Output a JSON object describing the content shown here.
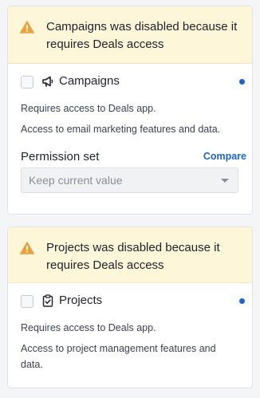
{
  "colors": {
    "warning_background": "#fdf6d8",
    "warning_icon": "#e8a33d",
    "link_blue": "#1a64d0",
    "status_dot": "#1a64d0"
  },
  "campaigns": {
    "warning": "Campaigns was disabled because it requires Deals access",
    "warning_icon": "warning-triangle-icon",
    "app_icon": "megaphone-icon",
    "label": "Campaigns",
    "checked": false,
    "requires": "Requires access to Deals app.",
    "access": "Access to email marketing features and data.",
    "permission_label": "Permission set",
    "compare_label": "Compare",
    "select_value": "Keep current value"
  },
  "projects": {
    "warning": "Projects was disabled because it requires Deals access",
    "warning_icon": "warning-triangle-icon",
    "app_icon": "clipboard-check-icon",
    "label": "Projects",
    "checked": false,
    "requires": "Requires access to Deals app.",
    "access": "Access to project management features and data."
  }
}
